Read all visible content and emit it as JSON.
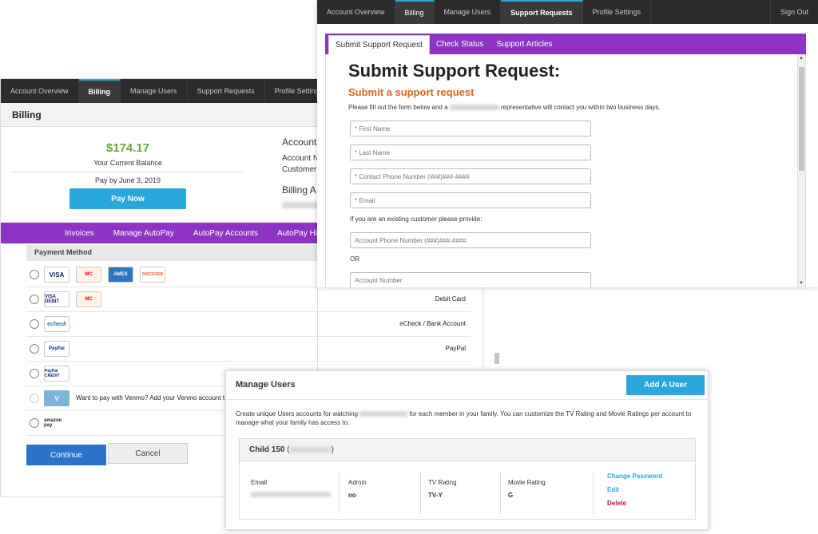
{
  "billing_panel": {
    "nav": [
      "Account Overview",
      "Billing",
      "Manage Users",
      "Support Requests",
      "Profile Settings"
    ],
    "active_nav": "Billing",
    "header": "Billing",
    "balance_amount": "$174.17",
    "balance_label": "Your Current Balance",
    "pay_by": "Pay by June 3, 2019",
    "pay_now": "Pay Now",
    "account_title": "Account",
    "account_line1": "Account N",
    "account_line2": "Customer",
    "billing_address": "Billing A",
    "subnav": [
      "Invoices",
      "Manage AutoPay",
      "AutoPay Accounts",
      "AutoPay History"
    ],
    "payment_method_header": "Payment Method",
    "payment_rows": [
      {
        "label": "",
        "cards": [
          "VISA",
          "MC",
          "AMEX",
          "DISCOVER"
        ]
      },
      {
        "label": "Debit Card",
        "cards": [
          "VISA DEBIT",
          "MC"
        ]
      },
      {
        "label": "eCheck / Bank Account",
        "cards": [
          "echeck"
        ]
      },
      {
        "label": "PayPal",
        "cards": [
          "PayPal"
        ]
      },
      {
        "label": "",
        "cards": [
          "PayPal CREDIT"
        ]
      },
      {
        "label": "Want to pay with Venmo? Add your Venmo account t",
        "cards": [
          "V"
        ]
      },
      {
        "label": "",
        "cards": [
          "amazon pay"
        ]
      }
    ],
    "continue": "Continue",
    "cancel": "Cancel"
  },
  "support_panel": {
    "nav": [
      "Account Overview",
      "Billing",
      "Manage Users",
      "Support Requests",
      "Profile Settings"
    ],
    "active_nav": "Support Requests",
    "sign_out": "Sign Out",
    "tabs": [
      "Submit Support Request",
      "Check Status",
      "Support Articles"
    ],
    "title": "Submit Support Request:",
    "subtitle": "Submit a support request",
    "description_start": "Please fill out the form below and a",
    "description_end": "representative will contact you within two business days.",
    "fields": {
      "first_name": "* First Name",
      "last_name": "* Last Name",
      "phone": "* Contact Phone Number (###)###-####",
      "email": "* Email",
      "account_phone": "Account Phone Number (###)###-####",
      "account_number": "Account Number"
    },
    "existing_note": "If you are an existing customer please provide:",
    "or_text": "OR"
  },
  "users_panel": {
    "title": "Manage Users",
    "add_user": "Add A User",
    "desc_start": "Create unique Users accounts for watching",
    "desc_end": "for each member in your family. You can customize the TV Rating and Movie Ratings per account to manage what your family has access to.",
    "child_name": "Child 150",
    "columns": {
      "email_label": "Email",
      "admin_label": "Admin",
      "admin_value": "no",
      "tv_label": "TV Rating",
      "tv_value": "TV-Y",
      "movie_label": "Movie Rating",
      "movie_value": "G"
    },
    "actions": {
      "change_password": "Change Password",
      "edit": "Edit",
      "delete": "Delete"
    },
    "colors": {
      "link": "#2aa7dc",
      "delete": "#c8102e"
    }
  }
}
